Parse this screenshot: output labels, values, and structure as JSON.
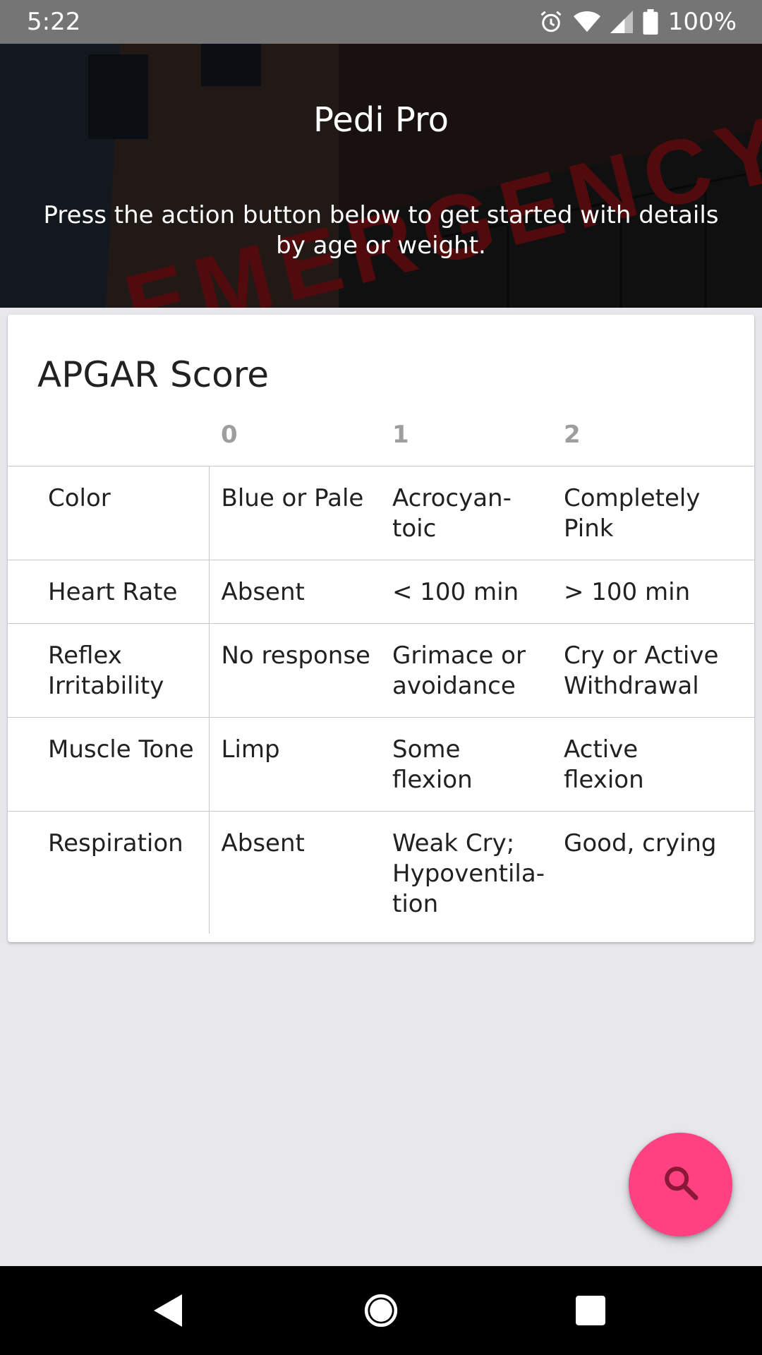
{
  "status_bar": {
    "time": "5:22",
    "battery_percent": "100%",
    "icons": [
      "alarm-icon",
      "wifi-icon",
      "signal-icon",
      "battery-icon"
    ]
  },
  "header": {
    "title": "Pedi Pro",
    "subtitle": "Press the action button below to get started with details by age or weight.",
    "background_image_text": "EMERGENCY"
  },
  "apgar": {
    "title": "APGAR Score",
    "columns": [
      "0",
      "1",
      "2"
    ],
    "rows": [
      {
        "label": "Color",
        "cells": [
          "Blue or Pale",
          "Acrocyan-\ntoic",
          "Completely\nPink"
        ]
      },
      {
        "label": "Heart Rate",
        "cells": [
          "Absent",
          "< 100 min",
          "> 100 min"
        ]
      },
      {
        "label": "Reflex\nIrritability",
        "cells": [
          "No response",
          "Grimace or\navoidance",
          "Cry or Active\nWithdrawal"
        ]
      },
      {
        "label": "Muscle Tone",
        "cells": [
          "Limp",
          "Some flexion",
          "Active\nflexion"
        ]
      },
      {
        "label": "Respiration",
        "cells": [
          "Absent",
          "Weak Cry;\nHypoventila-\ntion",
          "Good, crying"
        ]
      }
    ]
  },
  "fab": {
    "icon": "search-icon",
    "color": "#ff4081"
  },
  "colors": {
    "status_bar": "#757575",
    "background": "#e8e7ec",
    "card": "#ffffff",
    "column_header": "#9e9e9e"
  }
}
